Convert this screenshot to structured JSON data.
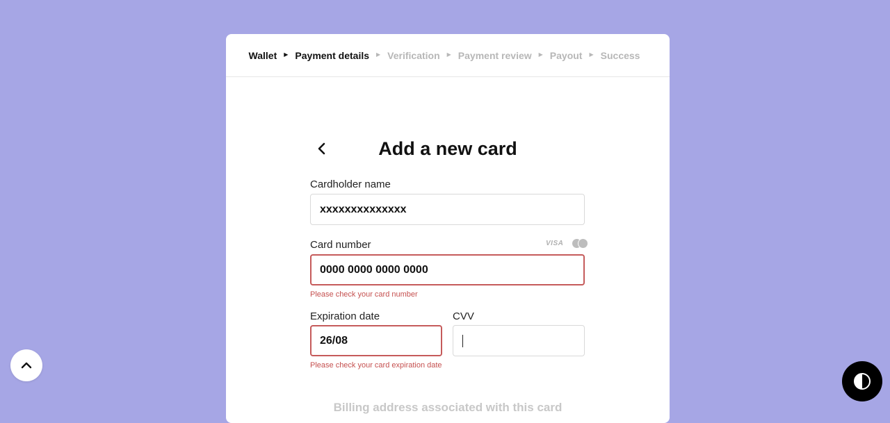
{
  "steps": [
    {
      "label": "Wallet",
      "state": "done"
    },
    {
      "label": "Payment details",
      "state": "done"
    },
    {
      "label": "Verification",
      "state": "pending"
    },
    {
      "label": "Payment review",
      "state": "pending"
    },
    {
      "label": "Payout",
      "state": "pending"
    },
    {
      "label": "Success",
      "state": "pending"
    }
  ],
  "form": {
    "title": "Add a new card",
    "cardholder": {
      "label": "Cardholder name",
      "value": "xxxxxxxxxxxxxx"
    },
    "card_number": {
      "label": "Card number",
      "value": "0000 0000 0000 0000",
      "error": "Please check your card number"
    },
    "brands": {
      "visa": "VISA"
    },
    "expiration": {
      "label": "Expiration date",
      "value": "26/08",
      "error": "Please check your card expiration date"
    },
    "cvv": {
      "label": "CVV",
      "value": ""
    },
    "billing_heading": "Billing address associated with this card"
  },
  "icons": {
    "back": "chevron-left-icon",
    "scroll_top": "chevron-up-icon",
    "contrast": "contrast-icon"
  },
  "colors": {
    "background": "#a6a6e5",
    "error": "#c5504f",
    "muted": "#b7b7b7"
  }
}
